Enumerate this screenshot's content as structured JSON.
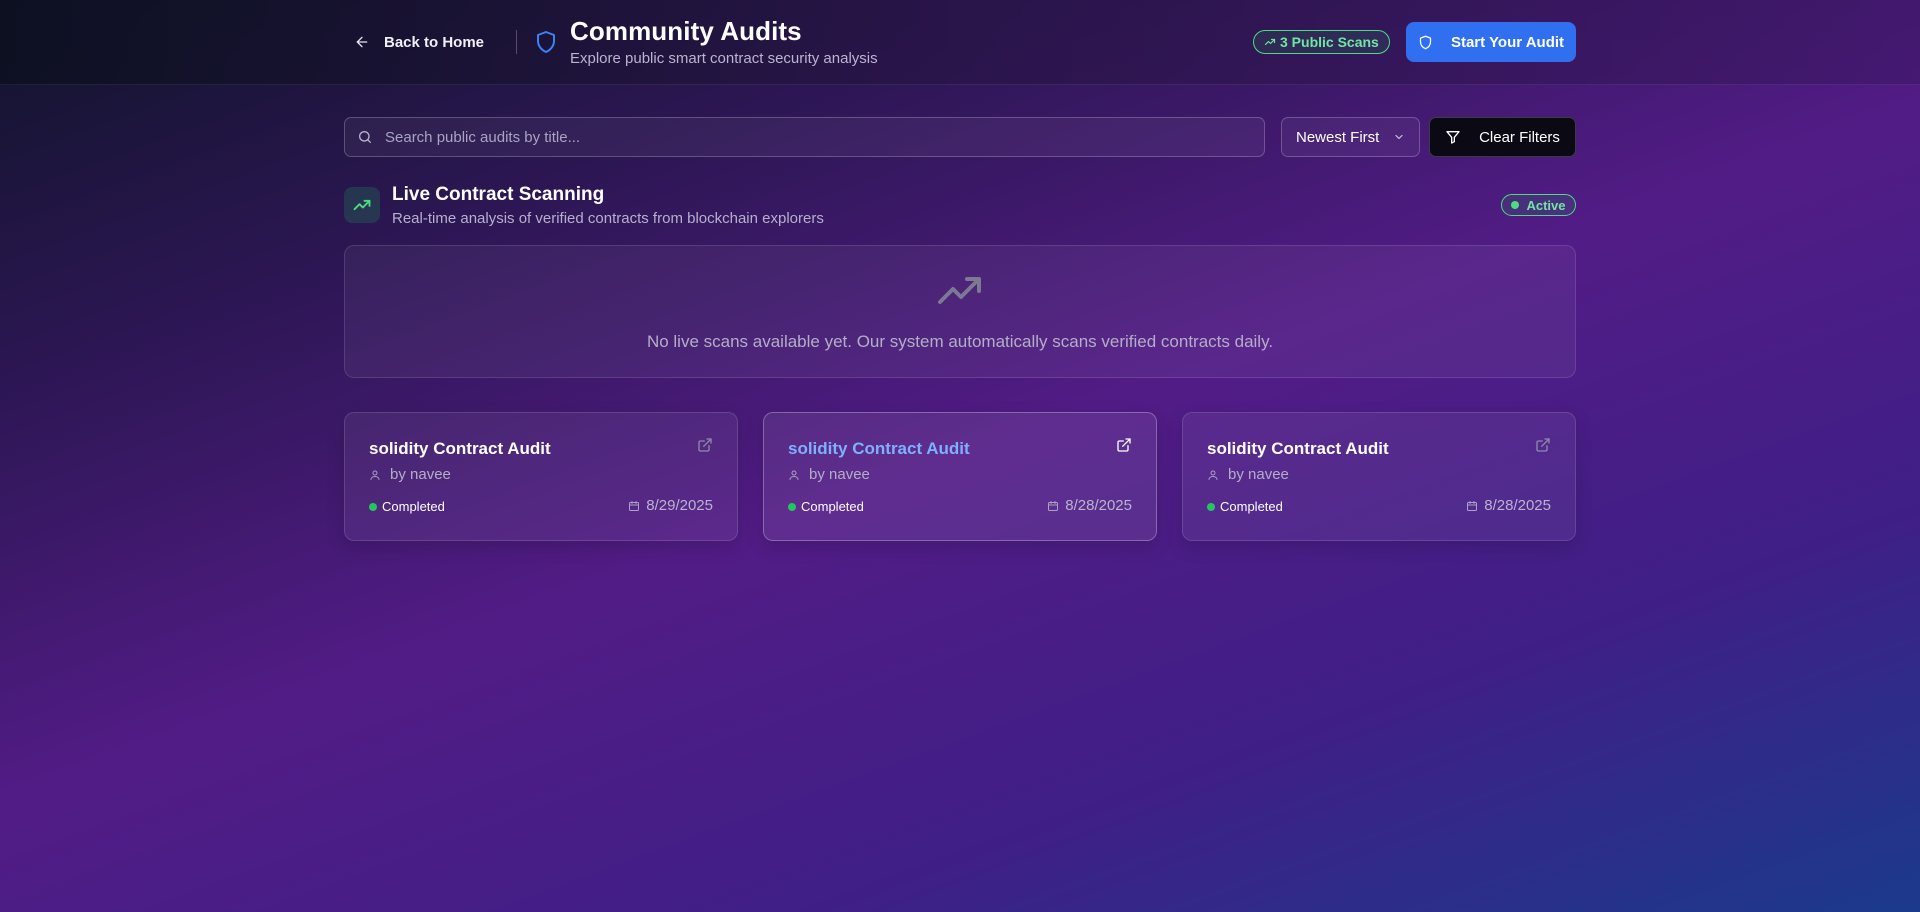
{
  "header": {
    "back_label": "Back to Home",
    "title": "Community Audits",
    "subtitle": "Explore public smart contract security analysis",
    "scans_badge": "3 Public Scans",
    "start_button": "Start Your Audit"
  },
  "filters": {
    "search_placeholder": "Search public audits by title...",
    "search_value": "",
    "sort_selected": "Newest First",
    "clear_button": "Clear Filters"
  },
  "live": {
    "title": "Live Contract Scanning",
    "subtitle": "Real-time analysis of verified contracts from blockchain explorers",
    "status_badge": "Active",
    "empty_message": "No live scans available yet. Our system automatically scans verified contracts daily."
  },
  "audits": [
    {
      "title": "solidity Contract Audit",
      "author": "by navee",
      "status": "Completed",
      "date": "8/29/2025"
    },
    {
      "title": "solidity Contract Audit",
      "author": "by navee",
      "status": "Completed",
      "date": "8/28/2025"
    },
    {
      "title": "solidity Contract Audit",
      "author": "by navee",
      "status": "Completed",
      "date": "8/28/2025"
    }
  ],
  "colors": {
    "accent_blue": "#2f6ff0",
    "success_green": "#22c55e",
    "hover_title": "#7fb0ff"
  },
  "icons": {
    "back": "arrow-left-icon",
    "logo": "shield-icon",
    "scans": "trending-up-icon",
    "start": "shield-icon",
    "search": "search-icon",
    "sort": "chevron-down-icon",
    "clear": "filter-icon",
    "live": "trending-up-icon",
    "card_link": "external-link-icon",
    "author": "user-icon",
    "date": "calendar-icon"
  }
}
